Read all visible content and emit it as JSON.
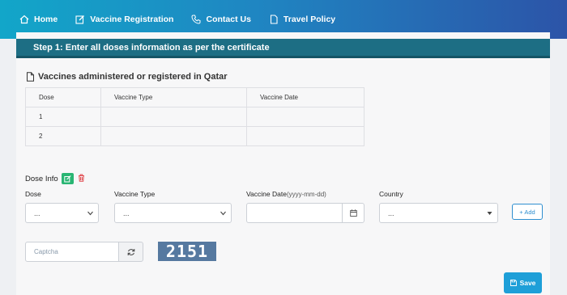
{
  "nav": {
    "items": [
      {
        "label": "Home",
        "icon": "home-icon"
      },
      {
        "label": "Vaccine Registration",
        "icon": "edit-icon"
      },
      {
        "label": "Contact Us",
        "icon": "phone-icon"
      },
      {
        "label": "Travel Policy",
        "icon": "document-icon"
      }
    ]
  },
  "step": {
    "title": "Step 1: Enter all doses information as per the certificate"
  },
  "section": {
    "title": "Vaccines administered or registered in Qatar"
  },
  "table": {
    "headers": [
      "Dose",
      "Vaccine Type",
      "Vaccine Date"
    ],
    "rows": [
      [
        "1",
        "",
        ""
      ],
      [
        "2",
        "",
        ""
      ]
    ]
  },
  "dose_info": {
    "label": "Dose Info"
  },
  "form": {
    "dose_label": "Dose",
    "dose_value": "...",
    "vaccine_type_label": "Vaccine Type",
    "vaccine_type_value": "...",
    "vaccine_date_label": "Vaccine Date",
    "vaccine_date_hint": "(yyyy-mm-dd)",
    "vaccine_date_value": "",
    "country_label": "Country",
    "country_value": "...",
    "add_label": "+ Add"
  },
  "captcha": {
    "placeholder": "Captcha",
    "code": "2151"
  },
  "save_label": "Save",
  "colors": {
    "nav_start": "#12a6c9",
    "nav_end": "#2c54a8",
    "step_bar": "#1d6e84",
    "save": "#1e9fd8",
    "edit": "#29b573",
    "delete": "#e0474c"
  }
}
